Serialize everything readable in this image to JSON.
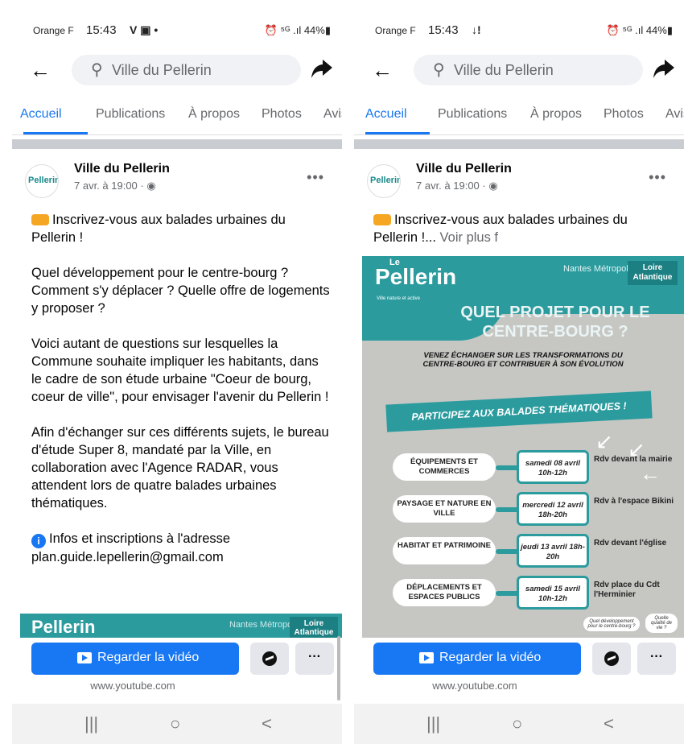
{
  "status": {
    "carrier": "Orange F",
    "time": "15:43",
    "left_icons": "V ▣ •",
    "left_icons_right": "↓!",
    "right_icons": "⏰ ⁵ᴳ .ıl 44%▮"
  },
  "search": {
    "query": "Ville du Pellerin"
  },
  "tabs": [
    "Accueil",
    "Publications",
    "À propos",
    "Photos",
    "Avis"
  ],
  "post": {
    "author": "Ville du Pellerin",
    "date": "7 avr. à 19:00 · ",
    "avatar_text": "Pellerin",
    "intro": "Inscrivez-vous aux balades urbaines du Pellerin !",
    "intro_truncated": "Inscrivez-vous aux balades urbaines du Pellerin !...",
    "see_more": "Voir plus f",
    "p2": "Quel développement pour le centre-bourg ? Comment s'y déplacer ? Quelle offre de logements y proposer ?",
    "p3": "Voici autant de questions sur lesquelles la Commune souhaite impliquer les habitants, dans le cadre de son étude urbaine \"Coeur de bourg, coeur de ville\", pour envisager l'avenir du Pellerin !",
    "p4": "Afin d'échanger sur ces différents sujets, le bureau d'étude Super 8, mandaté par la Ville, en collaboration avec l'Agence RADAR, vous attendent lors de quatre balades urbaines thématiques.",
    "p5": "Infos et inscriptions à l'adresse plan.guide.lepellerin@gmail.com"
  },
  "poster": {
    "logo": "Pellerin",
    "logo_small": "Le",
    "tagline": "Ville nature et active",
    "nantes": "Nantes Métropole",
    "loire": "Loire Atlantique",
    "title": "QUEL PROJET POUR LE CENTRE-BOURG ?",
    "subtitle": "VENEZ ÉCHANGER SUR LES TRANSFORMATIONS DU CENTRE-BOURG ET CONTRIBUER À SON ÉVOLUTION",
    "banner": "PARTICIPEZ AUX BALADES THÉMATIQUES !",
    "rows": [
      {
        "label": "ÉQUIPEMENTS ET COMMERCES",
        "date": "samedi 08 avril 10h-12h",
        "rdv": "Rdv devant la mairie"
      },
      {
        "label": "PAYSAGE ET NATURE EN VILLE",
        "date": "mercredi 12 avril 18h-20h",
        "rdv": "Rdv à l'espace Bikini"
      },
      {
        "label": "HABITAT ET PATRIMOINE",
        "date": "jeudi 13 avril 18h-20h",
        "rdv": "Rdv devant l'église"
      },
      {
        "label": "DÉPLACEMENTS ET ESPACES PUBLICS",
        "date": "samedi 15 avril 10h-12h",
        "rdv": "Rdv place du Cdt l'Herminier"
      }
    ],
    "bubble1": "Quel développement pour le centre-bourg ?",
    "bubble2": "Quelle qualité de vie ?"
  },
  "actions": {
    "watch": "Regarder la vidéo",
    "more": "···",
    "domain": "www.youtube.com"
  },
  "nav": {
    "recent": "|||",
    "home": "○",
    "back": "<"
  }
}
